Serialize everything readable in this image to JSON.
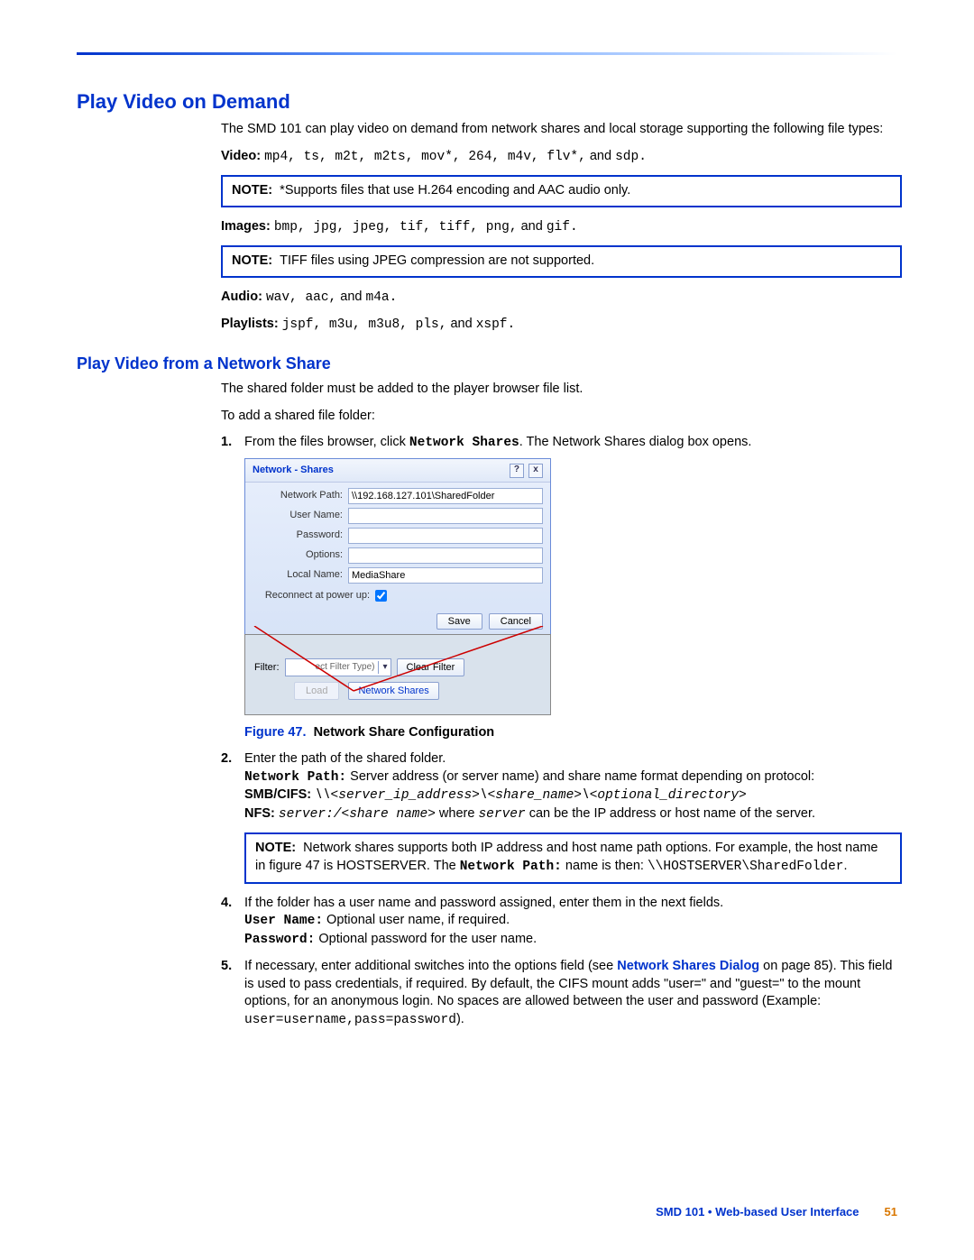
{
  "h1": "Play Video on Demand",
  "intro": "The SMD 101 can play video on demand from network shares and local storage supporting the following file types:",
  "video_label": "Video:",
  "video_codes": "mp4, ts, m2t, m2ts, mov*, 264, m4v, flv*,",
  "video_tail": " and ",
  "video_tail2": "sdp.",
  "note1_label": "NOTE:",
  "note1_text": "*Supports files that use H.264 encoding and AAC audio only.",
  "images_label": "Images:",
  "images_codes": "bmp, jpg, jpeg, tif, tiff, png,",
  "images_tail": " and ",
  "images_tail2": "gif.",
  "note2_label": "NOTE:",
  "note2_text": "TIFF files using JPEG compression are not supported.",
  "audio_label": "Audio:",
  "audio_codes": "wav, aac,",
  "audio_tail": " and ",
  "audio_tail2": "m4a.",
  "playlists_label": "Playlists:",
  "playlists_codes": "jspf, m3u, m3u8, pls,",
  "playlists_tail": " and ",
  "playlists_tail2": "xspf.",
  "h2": "Play Video from a Network Share",
  "p_shared": "The shared folder must be added to the player browser file list.",
  "p_toadd": "To add a shared file folder:",
  "step1_a": "From the files browser, click ",
  "step1_b": "Network Shares",
  "step1_c": ". The Network Shares dialog box opens.",
  "dialog": {
    "title": "Network - Shares",
    "np_label": "Network Path:",
    "np_value": "\\\\192.168.127.101\\SharedFolder",
    "un_label": "User Name:",
    "un_value": "",
    "pw_label": "Password:",
    "pw_value": "",
    "op_label": "Options:",
    "op_value": "",
    "ln_label": "Local Name:",
    "ln_value": "MediaShare",
    "re_label": "Reconnect at power up:",
    "save": "Save",
    "cancel": "Cancel",
    "help": "?",
    "close": "x"
  },
  "behind": {
    "filter_label": "Filter:",
    "filter_placeholder": "ect Filter Type)",
    "clear_filter": "Clear Filter",
    "load": "Load",
    "network_shares": "Network Shares"
  },
  "caption_a": "Figure 47.",
  "caption_b": "Network Share Configuration",
  "step2": "Enter the path of the shared folder.",
  "step2_np_label": "Network Path:",
  "step2_np_text": " Server address (or server name) and share name format depending on protocol:",
  "step2_smb_label": "SMB/CIFS:",
  "step2_smb_code": "\\\\<server_ip_address>\\<share_name>\\<optional_directory>",
  "step2_nfs_label": "NFS:",
  "step2_nfs_code": "server:/<share name>",
  "step2_nfs_mid": " where ",
  "step2_nfs_server": "server",
  "step2_nfs_tail": " can be the IP address or host name of the server.",
  "note3_label": "NOTE:",
  "note3_a": "Network shares supports both IP address and host name path options. For example, the host name in figure 47 is HOSTSERVER. The ",
  "note3_b": "Network Path:",
  "note3_c": " name is then: ",
  "note3_d": "\\\\HOSTSERVER\\SharedFolder",
  "note3_e": ".",
  "step4_a": "If the folder has a user name and password assigned, enter them in the next fields.",
  "step4_un_label": "User Name:",
  "step4_un_text": " Optional user name, if required.",
  "step4_pw_label": "Password:",
  "step4_pw_text": " Optional password for the user name.",
  "step5_a": "If necessary, enter additional switches into the options field (see ",
  "step5_link": "Network Shares Dialog",
  "step5_b": " on page 85). This field is used to pass credentials, if required. By default, the CIFS mount adds \"user=\" and \"guest=\" to the mount options, for an anonymous login. No spaces are allowed between the user and password (Example: ",
  "step5_c": "user=username,pass=password",
  "step5_d": ").",
  "footer_title": "SMD 101 • Web-based User Interface",
  "footer_page": "51"
}
